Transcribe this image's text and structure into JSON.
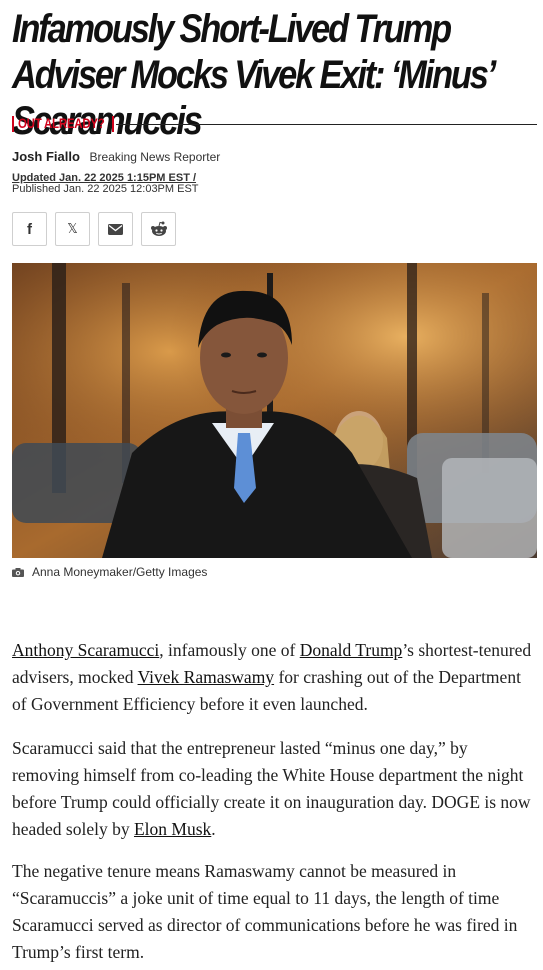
{
  "headline": "Infamously Short-Lived Trump Adviser Mocks Vivek Exit: ‘Minus’ Scaramuccis",
  "rubric": "OUT ALREADY?",
  "author": {
    "name": "Josh Fiallo",
    "role": "Breaking News Reporter"
  },
  "dates": {
    "updated": "Updated Jan. 22 2025 1:15PM EST /",
    "published": "Published Jan. 22 2025 12:03PM EST"
  },
  "share": {
    "facebook_icon": "f",
    "x_icon": "𝕏",
    "email_icon": "email-icon",
    "reddit_icon": "reddit-icon"
  },
  "photo": {
    "caption": "Anna Moneymaker/Getty Images"
  },
  "article": {
    "p1": {
      "link1": "Anthony Scaramucci",
      "t1": ", infamously one of ",
      "link2": "Donald Trump",
      "t2": "’s shortest-tenured advisers, mocked ",
      "link3": "Vivek Ramaswamy",
      "t3": " for crashing out of the Department of Government Efficiency before it even launched."
    },
    "p2": {
      "t1": "Scaramucci said that the entrepreneur lasted “minus one day,” by removing himself from co-leading the White House department the night before Trump could officially create it on inauguration day. DOGE is now headed solely by ",
      "link1": "Elon Musk",
      "t2": "."
    },
    "p3": "The negative tenure means Ramaswamy cannot be measured in “Scaramuccis” a joke unit of time equal to 11 days, the length of time Scaramucci served as director of communications before he was fired in Trump’s first term."
  },
  "colors": {
    "accent": "#d0021b",
    "text": "#111111"
  }
}
